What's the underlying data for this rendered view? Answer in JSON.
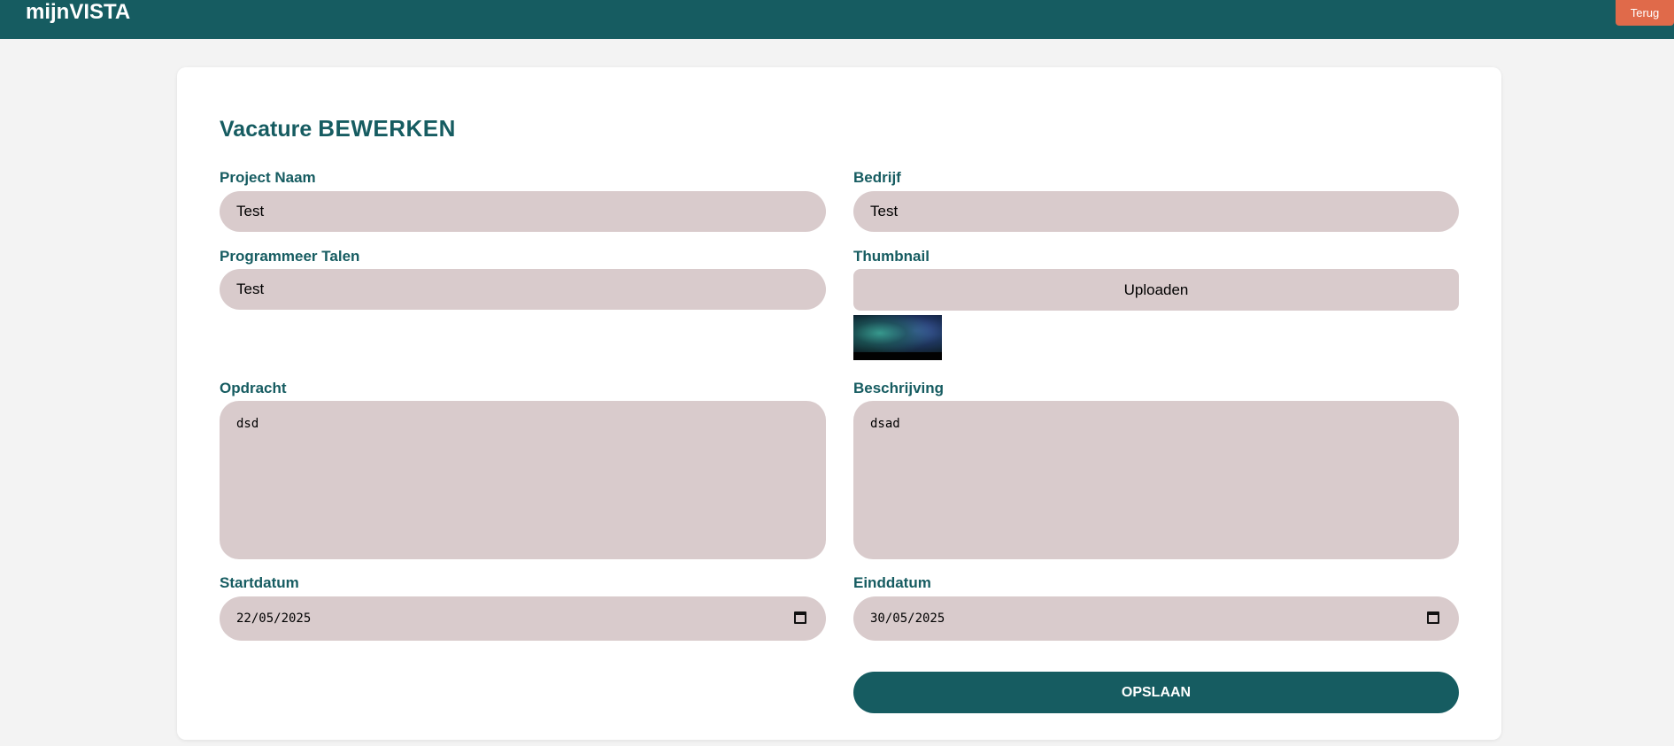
{
  "header": {
    "brand": "mijnVISTA",
    "back_label": "Terug"
  },
  "form": {
    "title_prefix": "Vacature",
    "title_emphasis": "BEWERKEN",
    "project_naam": {
      "label": "Project Naam",
      "value": "Test"
    },
    "bedrijf": {
      "label": "Bedrijf",
      "value": "Test"
    },
    "programmeer_talen": {
      "label": "Programmeer Talen",
      "value": "Test"
    },
    "thumbnail": {
      "label": "Thumbnail",
      "upload_label": "Uploaden"
    },
    "opdracht": {
      "label": "Opdracht",
      "value": "dsd"
    },
    "beschrijving": {
      "label": "Beschrijving",
      "value": "dsad"
    },
    "startdatum": {
      "label": "Startdatum",
      "value": "22/05/2025"
    },
    "einddatum": {
      "label": "Einddatum",
      "value": "30/05/2025"
    },
    "save_label": "OPSLAAN"
  },
  "colors": {
    "primary": "#165c61",
    "accent": "#e06a4a",
    "field_bg": "#d9cbcc",
    "page_bg": "#f3f3f3"
  },
  "icons": {
    "calendar": "calendar-icon"
  }
}
